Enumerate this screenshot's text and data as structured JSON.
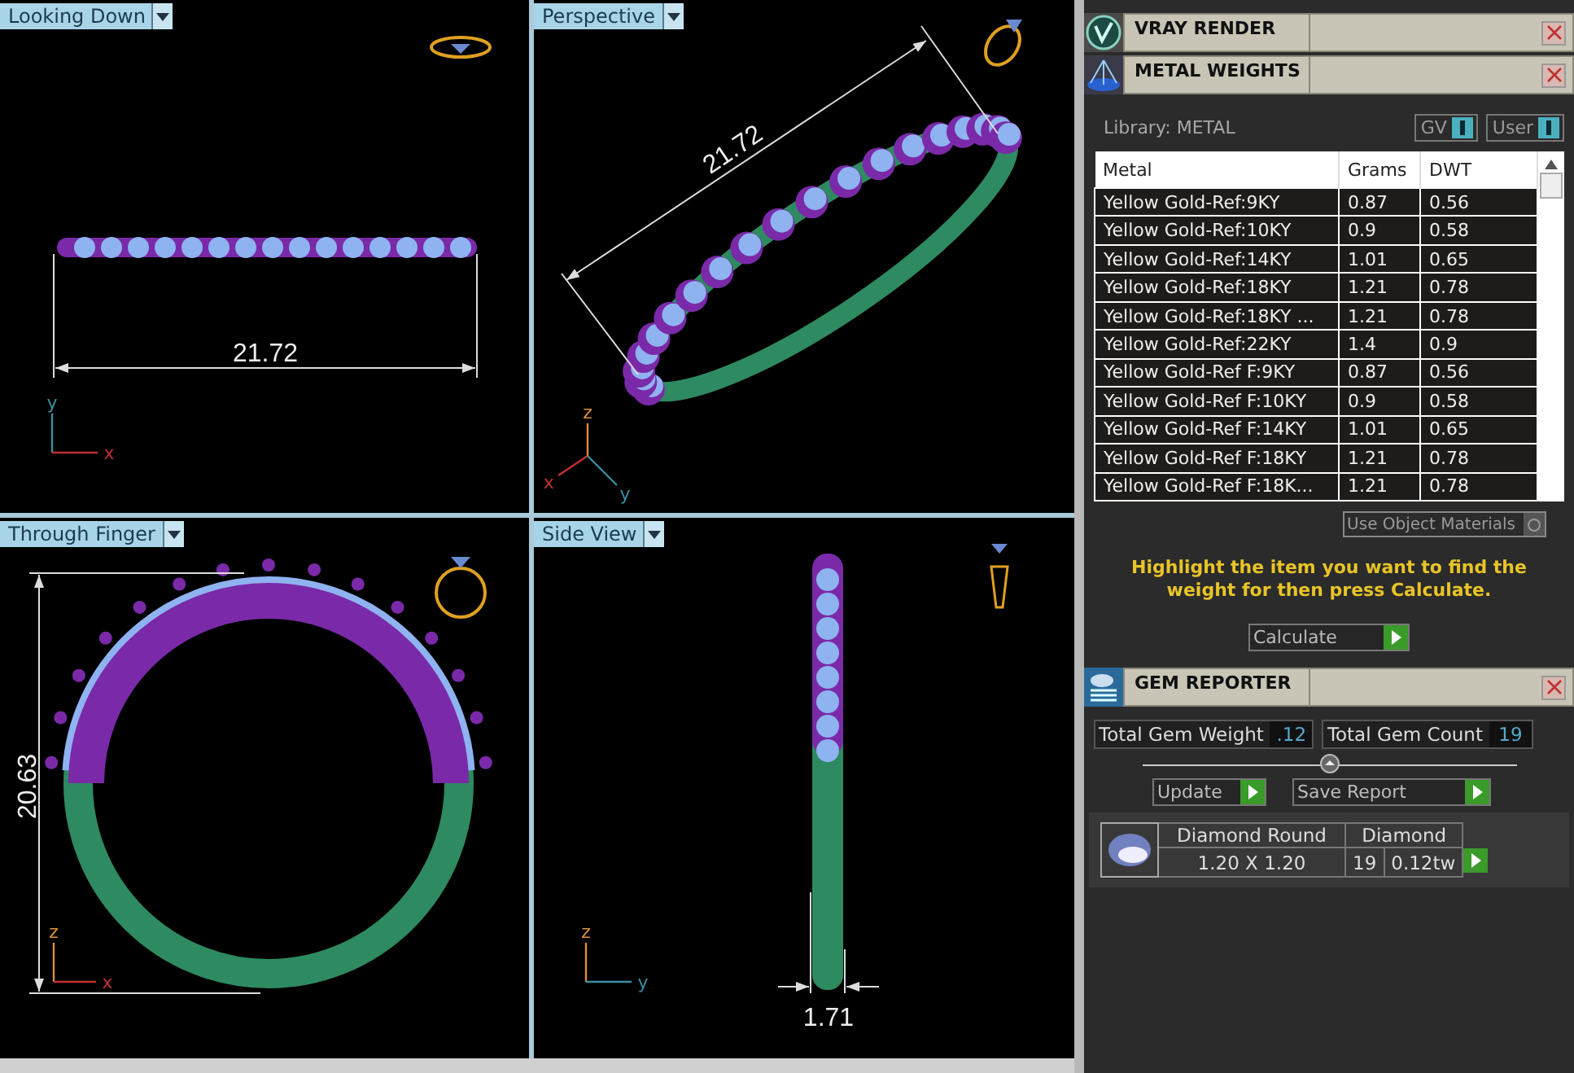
{
  "viewports": [
    {
      "label": "Looking Down",
      "kind": "top",
      "dimension": "21.72",
      "axes": [
        {
          "label": "y",
          "color": "#3a8fa0"
        },
        {
          "label": "x",
          "color": "#c03030"
        }
      ]
    },
    {
      "label": "Perspective",
      "kind": "perspective",
      "dimension": "21.72",
      "axes": [
        {
          "label": "z",
          "color": "#d89040"
        },
        {
          "label": "x",
          "color": "#c03030"
        },
        {
          "label": "y",
          "color": "#3a8fa0"
        }
      ]
    },
    {
      "label": "Through Finger",
      "kind": "front",
      "dimension": "20.63",
      "axes": [
        {
          "label": "z",
          "color": "#d89040"
        },
        {
          "label": "x",
          "color": "#c03030"
        }
      ]
    },
    {
      "label": "Side View",
      "kind": "side",
      "dimension": "1.71",
      "axes": [
        {
          "label": "z",
          "color": "#d89040"
        },
        {
          "label": "y",
          "color": "#3a8fa0"
        }
      ]
    }
  ],
  "panels": [
    {
      "title": "VRAY RENDER",
      "kind": "vray"
    },
    {
      "title": "METAL WEIGHTS",
      "kind": "metal"
    }
  ],
  "metal_weights": {
    "library": "Library: METAL",
    "toggles": [
      {
        "label": "GV",
        "on": true
      },
      {
        "label": "User",
        "on": true
      }
    ],
    "columns": [
      "Metal",
      "Grams",
      "DWT"
    ],
    "rows": [
      [
        "Yellow Gold-Ref:9KY",
        "0.87",
        "0.56"
      ],
      [
        "Yellow Gold-Ref:10KY",
        "0.9",
        "0.58"
      ],
      [
        "Yellow Gold-Ref:14KY",
        "1.01",
        "0.65"
      ],
      [
        "Yellow Gold-Ref:18KY",
        "1.21",
        "0.78"
      ],
      [
        "Yellow Gold-Ref:18KY ...",
        "1.21",
        "0.78"
      ],
      [
        "Yellow Gold-Ref:22KY",
        "1.4",
        "0.9"
      ],
      [
        "Yellow Gold-Ref F:9KY",
        "0.87",
        "0.56"
      ],
      [
        "Yellow Gold-Ref F:10KY",
        "0.9",
        "0.58"
      ],
      [
        "Yellow Gold-Ref F:14KY",
        "1.01",
        "0.65"
      ],
      [
        "Yellow Gold-Ref F:18KY",
        "1.21",
        "0.78"
      ],
      [
        "Yellow Gold-Ref F:18K...",
        "1.21",
        "0.78"
      ]
    ],
    "use_object_materials": "Use Object Materials",
    "use_object_materials_checked": false,
    "hint": "Highlight the item you want to find the weight for then press Calculate.",
    "calculate": "Calculate"
  },
  "gem_reporter": {
    "title": "GEM REPORTER",
    "total_weight_label": "Total Gem Weight",
    "total_weight": ".12",
    "total_count_label": "Total Gem Count",
    "total_count": "19",
    "update": "Update",
    "save": "Save Report",
    "gems": [
      {
        "shape": "Diamond Round",
        "material": "Diamond",
        "size": "1.20 X 1.20",
        "count": "19",
        "weight": "0.12tw"
      }
    ]
  }
}
